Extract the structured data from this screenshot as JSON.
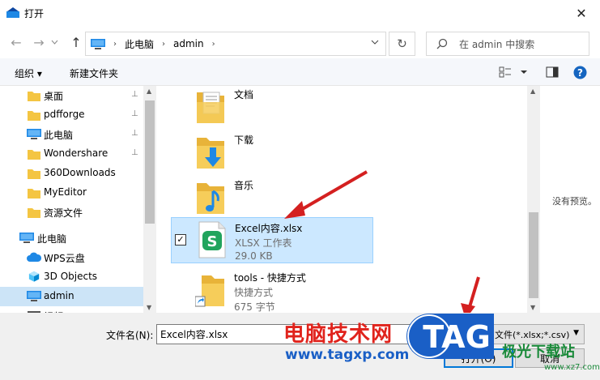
{
  "window": {
    "title": "打开",
    "close_glyph": "✕"
  },
  "nav": {
    "back_glyph": "←",
    "forward_glyph": "→",
    "up_glyph": "↑",
    "breadcrumb": [
      "此电脑",
      "admin"
    ],
    "refresh_glyph": "↻",
    "search_placeholder": "在 admin 中搜索"
  },
  "toolbar": {
    "organize_label": "组织 ▾",
    "new_folder_label": "新建文件夹"
  },
  "sidebar": {
    "items": [
      {
        "label": "桌面",
        "icon": "folder-icon",
        "pinned": true
      },
      {
        "label": "pdfforge",
        "icon": "folder-icon",
        "pinned": true
      },
      {
        "label": "此电脑",
        "icon": "computer-icon",
        "pinned": true
      },
      {
        "label": "Wondershare",
        "icon": "folder-icon",
        "pinned": true
      },
      {
        "label": "360Downloads",
        "icon": "folder-icon",
        "pinned": false
      },
      {
        "label": "MyEditor",
        "icon": "folder-icon",
        "pinned": false
      },
      {
        "label": "资源文件",
        "icon": "folder-icon",
        "pinned": false
      },
      {
        "label": "此电脑",
        "icon": "computer-icon",
        "pinned": false
      },
      {
        "label": "WPS云盘",
        "icon": "cloud-icon",
        "pinned": false
      },
      {
        "label": "3D Objects",
        "icon": "cube-icon",
        "pinned": false
      },
      {
        "label": "admin",
        "icon": "computer-icon",
        "pinned": false,
        "selected": true
      },
      {
        "label": "视频",
        "icon": "video-icon",
        "pinned": false
      }
    ],
    "pin_glyph": "📌"
  },
  "files": [
    {
      "name": "文档",
      "type": "",
      "size": "",
      "icon": "documents-folder-icon"
    },
    {
      "name": "下载",
      "type": "",
      "size": "",
      "icon": "downloads-folder-icon"
    },
    {
      "name": "音乐",
      "type": "",
      "size": "",
      "icon": "music-folder-icon"
    },
    {
      "name": "Excel内容.xlsx",
      "type": "XLSX 工作表",
      "size": "29.0 KB",
      "icon": "wps-spreadsheet-icon",
      "selected": true,
      "check_glyph": "✓"
    },
    {
      "name": "tools - 快捷方式",
      "type": "快捷方式",
      "size": "675 字节",
      "icon": "shortcut-folder-icon"
    }
  ],
  "preview": {
    "text": "没有预览。"
  },
  "footer": {
    "filename_label": "文件名(N):",
    "filename_value": "Excel内容.xlsx",
    "filter_value": "文件(*.xlsx;*.csv)",
    "open_label": "打开(O)",
    "cancel_label": "取消"
  },
  "watermark": {
    "text1": "电脑技术网",
    "text2": "www.tagxp.com",
    "tag": "TAG",
    "site": "极光下载站",
    "url": "www.xz7.com"
  },
  "colors": {
    "accent": "#0078d7",
    "selection": "#cce8ff",
    "arrow": "#d42020"
  }
}
